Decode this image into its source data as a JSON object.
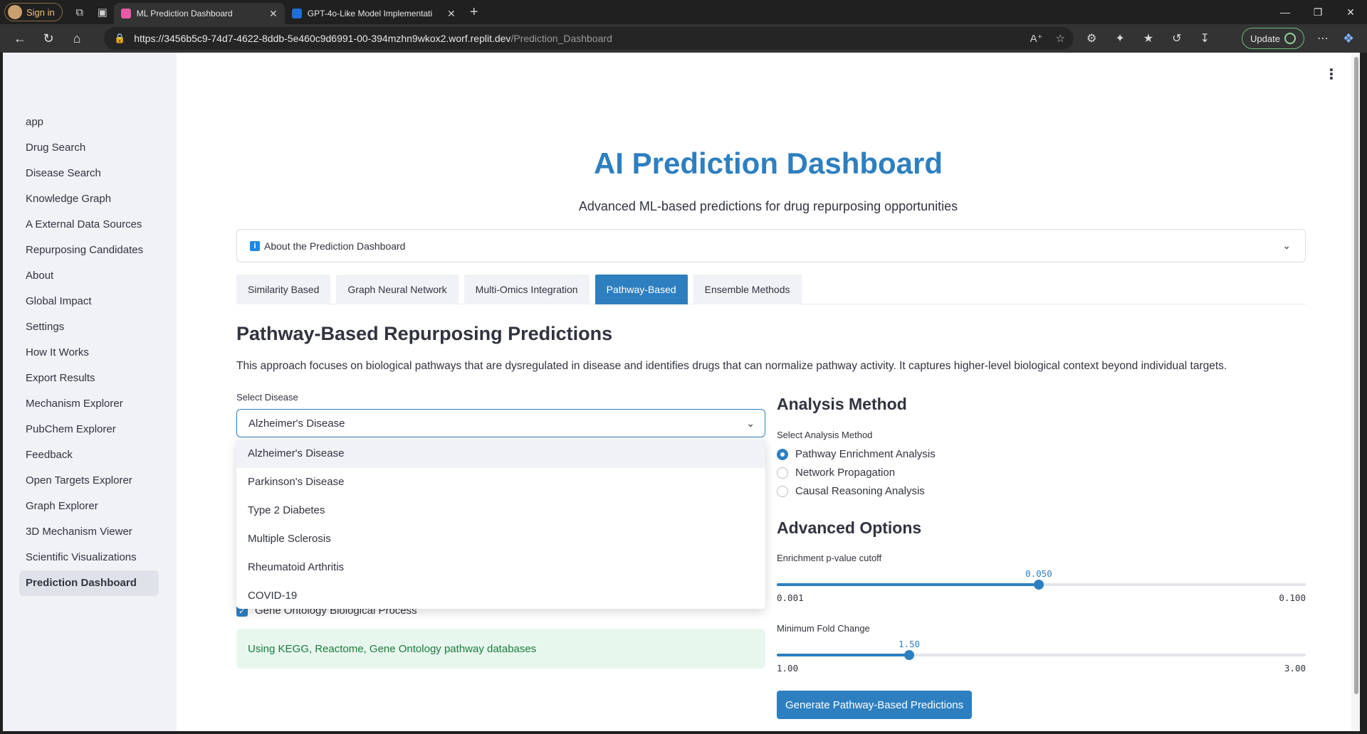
{
  "browser": {
    "profile_label": "Sign in",
    "tabs": [
      {
        "title": "ML Prediction Dashboard",
        "active": true
      },
      {
        "title": "GPT-4o-Like Model Implementati",
        "active": false
      }
    ],
    "url_main": "https://3456b5c9-74d7-4622-8ddb-5e460c9d6991-00-394mzhn9wkox2.worf.replit.dev",
    "url_path": "/Prediction_Dashboard",
    "update_label": "Update",
    "colors": {
      "active_tab": "#333333",
      "favicon_1": "#e85aa8",
      "favicon_2": "#1e6fd9"
    }
  },
  "sidebar": {
    "items": [
      {
        "label": "app",
        "active": false
      },
      {
        "label": "Drug Search",
        "active": false
      },
      {
        "label": "Disease Search",
        "active": false
      },
      {
        "label": "Knowledge Graph",
        "active": false
      },
      {
        "label": "A External Data Sources",
        "active": false
      },
      {
        "label": "Repurposing Candidates",
        "active": false
      },
      {
        "label": "About",
        "active": false
      },
      {
        "label": "Global Impact",
        "active": false
      },
      {
        "label": "Settings",
        "active": false
      },
      {
        "label": "How It Works",
        "active": false
      },
      {
        "label": "Export Results",
        "active": false
      },
      {
        "label": "Mechanism Explorer",
        "active": false
      },
      {
        "label": "PubChem Explorer",
        "active": false
      },
      {
        "label": "Feedback",
        "active": false
      },
      {
        "label": "Open Targets Explorer",
        "active": false
      },
      {
        "label": "Graph Explorer",
        "active": false
      },
      {
        "label": "3D Mechanism Viewer",
        "active": false
      },
      {
        "label": "Scientific Visualizations",
        "active": false
      },
      {
        "label": "Prediction Dashboard",
        "active": true
      }
    ]
  },
  "header": {
    "title": "AI Prediction Dashboard",
    "subtitle": "Advanced ML-based predictions for drug repurposing opportunities"
  },
  "expander": {
    "label": "About the Prediction Dashboard"
  },
  "tabs": [
    {
      "label": "Similarity Based",
      "active": false
    },
    {
      "label": "Graph Neural Network",
      "active": false
    },
    {
      "label": "Multi-Omics Integration",
      "active": false
    },
    {
      "label": "Pathway-Based",
      "active": true
    },
    {
      "label": "Ensemble Methods",
      "active": false
    }
  ],
  "section": {
    "title": "Pathway-Based Repurposing Predictions",
    "description": "This approach focuses on biological pathways that are dysregulated in disease and identifies drugs that can normalize pathway activity. It captures higher-level biological context beyond individual targets."
  },
  "disease_select": {
    "label": "Select Disease",
    "value": "Alzheimer's Disease",
    "options": [
      "Alzheimer's Disease",
      "Parkinson's Disease",
      "Type 2 Diabetes",
      "Multiple Sclerosis",
      "Rheumatoid Arthritis",
      "COVID-19"
    ]
  },
  "checkbox": {
    "label": "Gene Ontology Biological Process",
    "checked": true
  },
  "info_box": {
    "text": "Using KEGG, Reactome, Gene Ontology pathway databases"
  },
  "analysis": {
    "title": "Analysis Method",
    "radio_label": "Select Analysis Method",
    "options": [
      {
        "label": "Pathway Enrichment Analysis",
        "selected": true
      },
      {
        "label": "Network Propagation",
        "selected": false
      },
      {
        "label": "Causal Reasoning Analysis",
        "selected": false
      }
    ]
  },
  "advanced": {
    "title": "Advanced Options",
    "pvalue": {
      "label": "Enrichment p-value cutoff",
      "value": "0.050",
      "min": "0.001",
      "max": "0.100",
      "fraction": 0.495
    },
    "fold": {
      "label": "Minimum Fold Change",
      "value": "1.50",
      "min": "1.00",
      "max": "3.00",
      "fraction": 0.25
    }
  },
  "generate_button": "Generate Pathway-Based Predictions",
  "theme": {
    "primary": "#2d7fc0",
    "sidebar_bg": "#f0f2f6",
    "success_bg": "#e8f7ee",
    "success_text": "#1a7a3c"
  }
}
